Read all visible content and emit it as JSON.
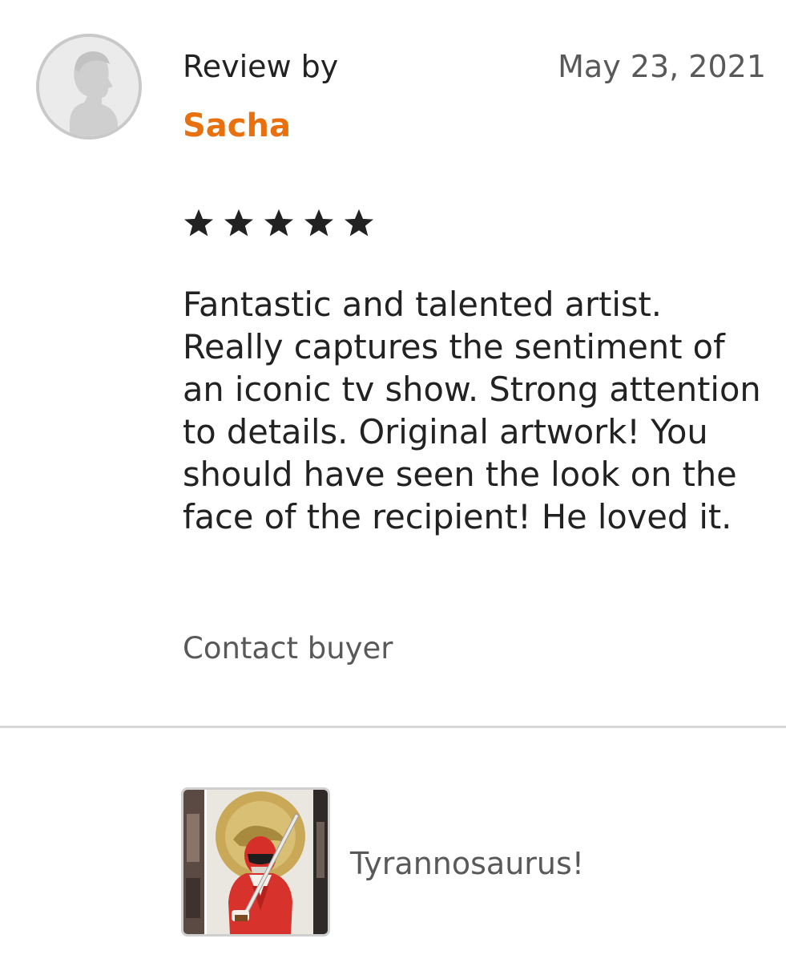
{
  "review": {
    "label": "Review by",
    "reviewer": "Sacha",
    "date": "May 23, 2021",
    "rating": 5,
    "rating_max": 5,
    "text": "Fantastic and talented artist. Really captures the sentiment of an iconic tv show. Strong attention to details. Original artwork! You should have seen the look on the face of the recipient! He loved it.",
    "contact_label": "Contact buyer"
  },
  "listing": {
    "title": "Tyrannosaurus!"
  },
  "icons": {
    "avatar": "default-user-avatar-icon",
    "star": "star-icon"
  },
  "colors": {
    "reviewer_name": "#e8700f",
    "text": "#222222",
    "muted": "#595959",
    "divider": "#d6d6d6"
  }
}
